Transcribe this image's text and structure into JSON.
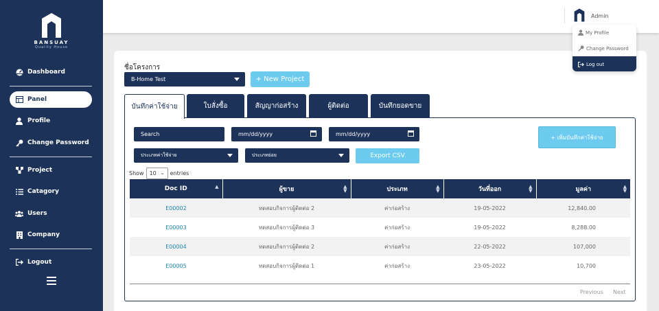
{
  "brand": {
    "name": "BANSUAY",
    "tagline": "Quality House"
  },
  "sidebar": {
    "items": [
      {
        "label": "Dashboard",
        "icon": "dashboard-icon"
      },
      {
        "label": "Panel",
        "icon": "panel-icon",
        "active": true
      },
      {
        "label": "Profile",
        "icon": "user-icon"
      },
      {
        "label": "Change Password",
        "icon": "key-icon"
      },
      {
        "label": "Project",
        "icon": "project-icon"
      },
      {
        "label": "Catagory",
        "icon": "list-icon"
      },
      {
        "label": "Users",
        "icon": "users-icon"
      },
      {
        "label": "Company",
        "icon": "building-icon"
      },
      {
        "label": "Logout",
        "icon": "logout-icon"
      }
    ]
  },
  "header": {
    "user": "Admin"
  },
  "user_menu": {
    "profile": "My Profile",
    "change_password": "Change Password",
    "logout": "Log out"
  },
  "project": {
    "label": "ชื่อโครงการ",
    "selected": "B-Home Test",
    "new_button": "+ New Project"
  },
  "tabs": [
    "บันทึกค่าใช้จ่าย",
    "ใบสั่งซื้อ",
    "สัญญาก่อสร้าง",
    "ผู้ติดต่อ",
    "บันทึกยอดขาย"
  ],
  "filters": {
    "search": "Search",
    "date_from": "mm/dd/yyyy",
    "date_to": "mm/dd/yyyy",
    "expense_type": "ประเภทค่าใช้จ่าย",
    "sub_type": "ประเภทย่อย",
    "export": "Export CSV",
    "add_expense": "+ เพิ่มบันทึกค่าใช้จ่าย"
  },
  "table": {
    "show": "Show",
    "page_size": "10",
    "entries": "entries",
    "columns": [
      "Doc ID",
      "ผู้ขาย",
      "ประเภท",
      "วันที่ออก",
      "มูลค่า"
    ],
    "rows": [
      [
        "E00002",
        "ทดสอบกิจการผู้ติดต่อ 2",
        "ค่าก่อสร้าง",
        "19-05-2022",
        "12,840.00"
      ],
      [
        "E00003",
        "ทดสอบกิจการผู้ติดต่อ 3",
        "ค่าก่อสร้าง",
        "19-05-2022",
        "8,288.00"
      ],
      [
        "E00004",
        "ทดสอบกิจการผู้ติดต่อ 2",
        "ค่าก่อสร้าง",
        "22-05-2022",
        "107,000"
      ],
      [
        "E00005",
        "ทดสอบกิจการผู้ติดต่อ 1",
        "ค่าก่อสร้าง",
        "23-05-2022",
        "10,700"
      ]
    ],
    "previous": "Previous",
    "next": "Next"
  },
  "colors": {
    "primary": "#1c3258",
    "accent": "#6ccbef",
    "link": "#1b84b5"
  }
}
